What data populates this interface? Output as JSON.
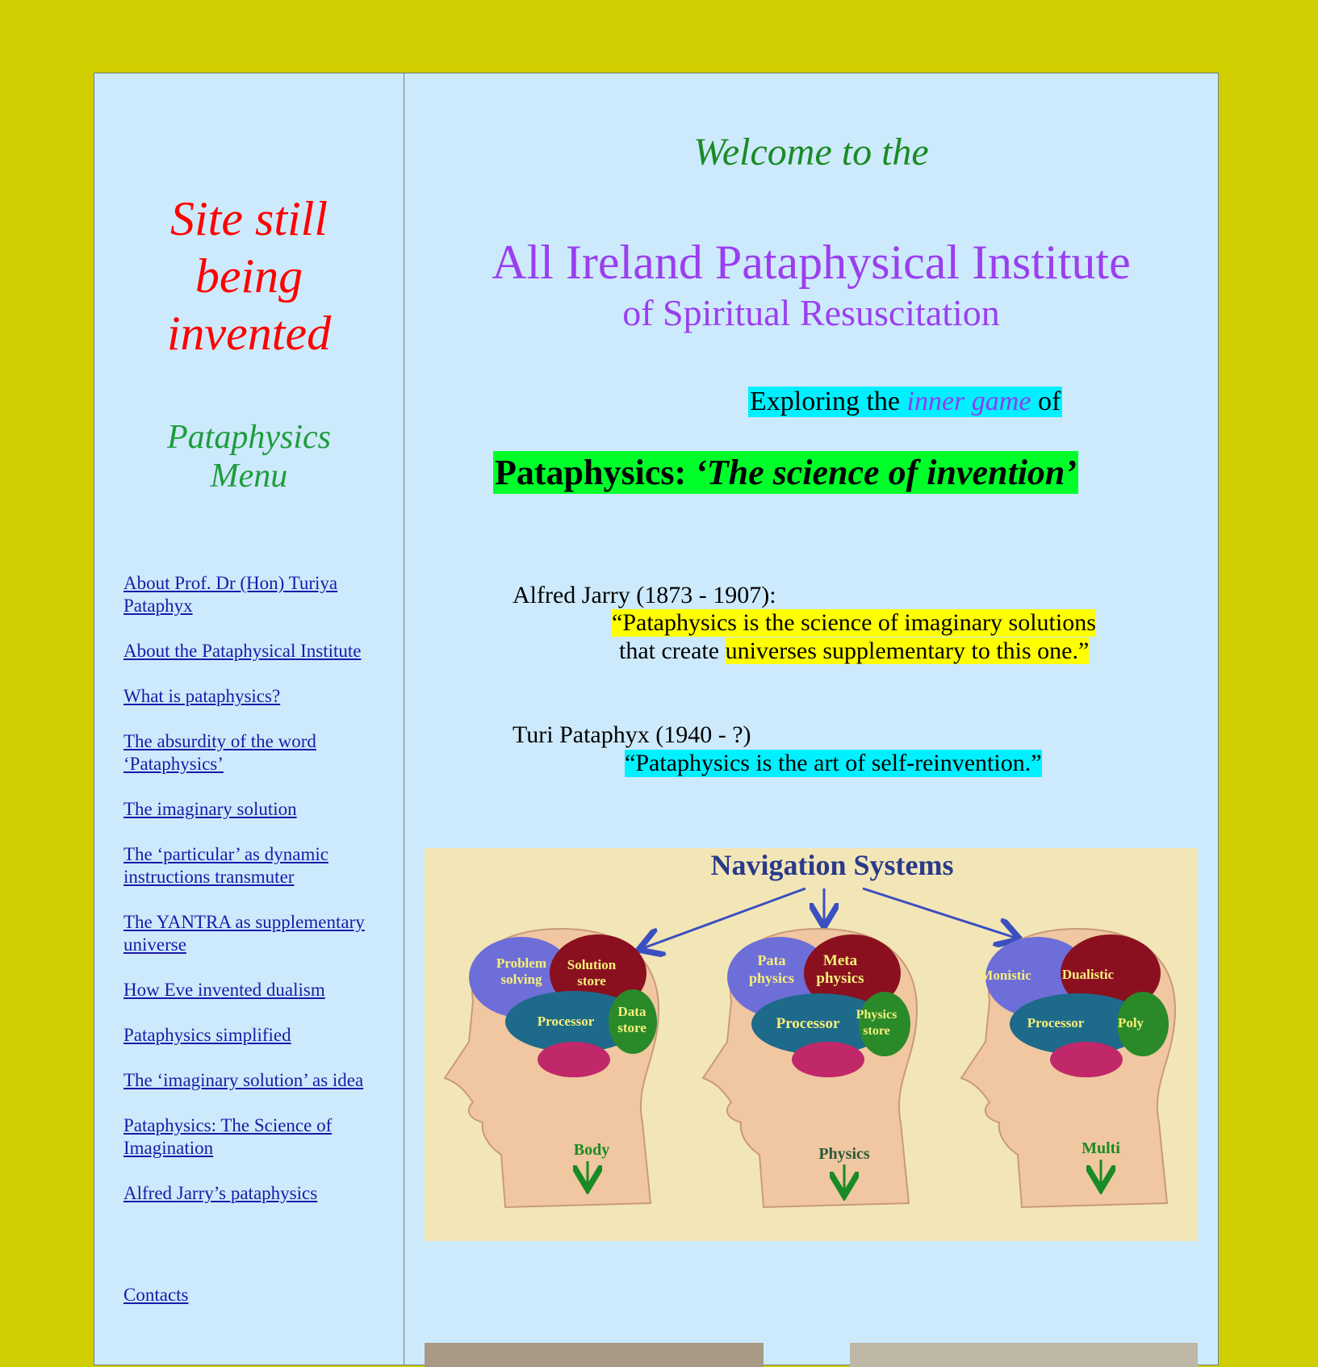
{
  "colors": {
    "page_bg": "#d0ce00",
    "panel_bg": "#cdeafc",
    "notice": "#ff0000",
    "menu_title": "#1f9c3e",
    "link": "#1a1aa8",
    "welcome": "#1a8a25",
    "institute": "#9a3ff0",
    "highlight_cyan": "#00f0ff",
    "highlight_green": "#00ff2a",
    "highlight_yellow": "#ffff00"
  },
  "sidebar": {
    "notice_lines": [
      "Site still",
      "being",
      "invented"
    ],
    "menu_title_lines": [
      "Pataphysics",
      "Menu"
    ],
    "menu_items": [
      {
        "label": "About Prof. Dr (Hon) Turiya Pataphyx"
      },
      {
        "label": "About the Pataphysical Institute"
      },
      {
        "label": "What is pataphysics?"
      },
      {
        "label": "The absurdity of the word ‘Pataphysics’"
      },
      {
        "label": "The imaginary solution"
      },
      {
        "label": "The ‘particular’ as dynamic instructions transmuter"
      },
      {
        "label": "The YANTRA as supplementary universe"
      },
      {
        "label": "How Eve invented dualism"
      },
      {
        "label": "Pataphysics simplified"
      },
      {
        "label": "The ‘imaginary solution’ as idea"
      },
      {
        "label": "Pataphysics: The Science of Imagination"
      },
      {
        "label": "Alfred Jarry’s pataphysics"
      }
    ],
    "contacts": "Contacts"
  },
  "main": {
    "welcome": "Welcome to the",
    "institute_title": "All Ireland Pataphysical Institute",
    "institute_subtitle": "of Spiritual Resuscitation",
    "exploring_prefix": "Exploring the ",
    "exploring_italic": "inner game",
    "exploring_suffix": " of",
    "science_prefix": "Pataphysics: ",
    "science_italic": "‘The science of invention’",
    "quote1_author": "Alfred Jarry (1873 - 1907):",
    "quote1_line1": "“Pataphysics is the science of imaginary solutions",
    "quote1_line2_plain": "that create ",
    "quote1_line2_highlight": "universes supplementary to this one.”",
    "quote2_author": "Turi Pataphyx (1940 -  ?)",
    "quote2_text": "“Pataphysics is the art of self-reinvention.”"
  },
  "navigation_image": {
    "title": "Navigation Systems",
    "heads": [
      {
        "regions": [
          "Problem",
          "solving",
          "Solution",
          "store",
          "Processor",
          "Data",
          "store"
        ],
        "output": "Body"
      },
      {
        "regions": [
          "Pata",
          "physics",
          "Meta",
          "physics",
          "Processor",
          "Physics",
          "store"
        ],
        "output": "Physics"
      },
      {
        "regions": [
          "Monistic",
          "Dualistic",
          "Processor",
          "Poly"
        ],
        "output": "Multi"
      }
    ]
  }
}
